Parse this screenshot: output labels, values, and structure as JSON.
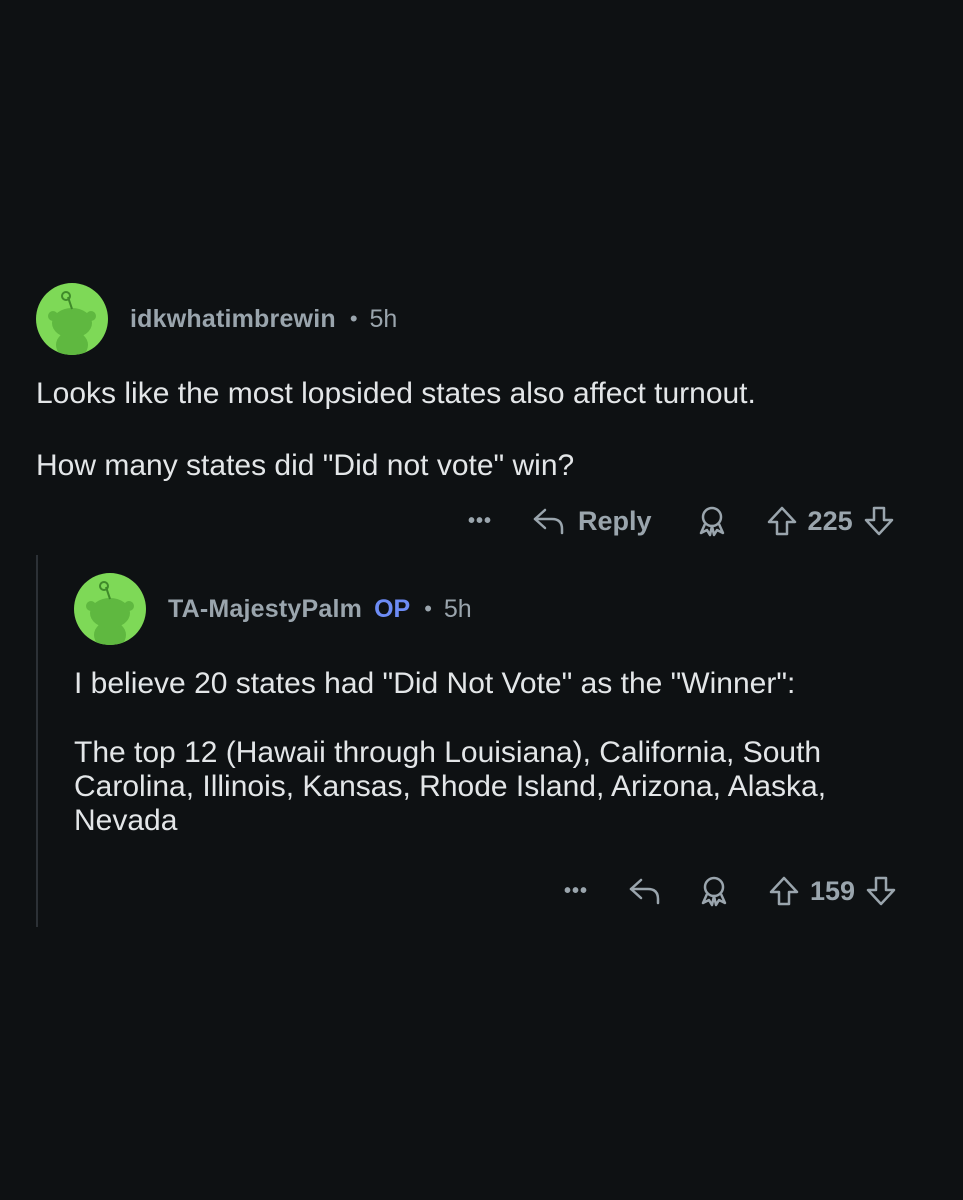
{
  "comments": [
    {
      "username": "idkwhatimbrewin",
      "is_op": false,
      "time": "5h",
      "paragraphs": [
        "Looks like the most lopsided states also affect turnout.",
        "How many states did \"Did not vote\" win?"
      ],
      "actions": {
        "more_label": "•••",
        "reply_label": "Reply",
        "score": "225"
      }
    },
    {
      "username": "TA-MajestyPalm",
      "is_op": true,
      "op_badge": "OP",
      "time": "5h",
      "paragraphs": [
        "I believe 20 states had \"Did Not Vote\" as the \"Winner\":",
        "The top 12 (Hawaii through Louisiana), California, South Carolina, Illinois, Kansas, Rhode Island, Arizona, Alaska, Nevada"
      ],
      "actions": {
        "more_label": "•••",
        "reply_label": "",
        "score": "159"
      }
    }
  ],
  "separator": "•",
  "colors": {
    "background": "#0e1113",
    "avatar": "#7ed957",
    "op": "#6d8cf5",
    "muted": "#9aa5ad"
  }
}
